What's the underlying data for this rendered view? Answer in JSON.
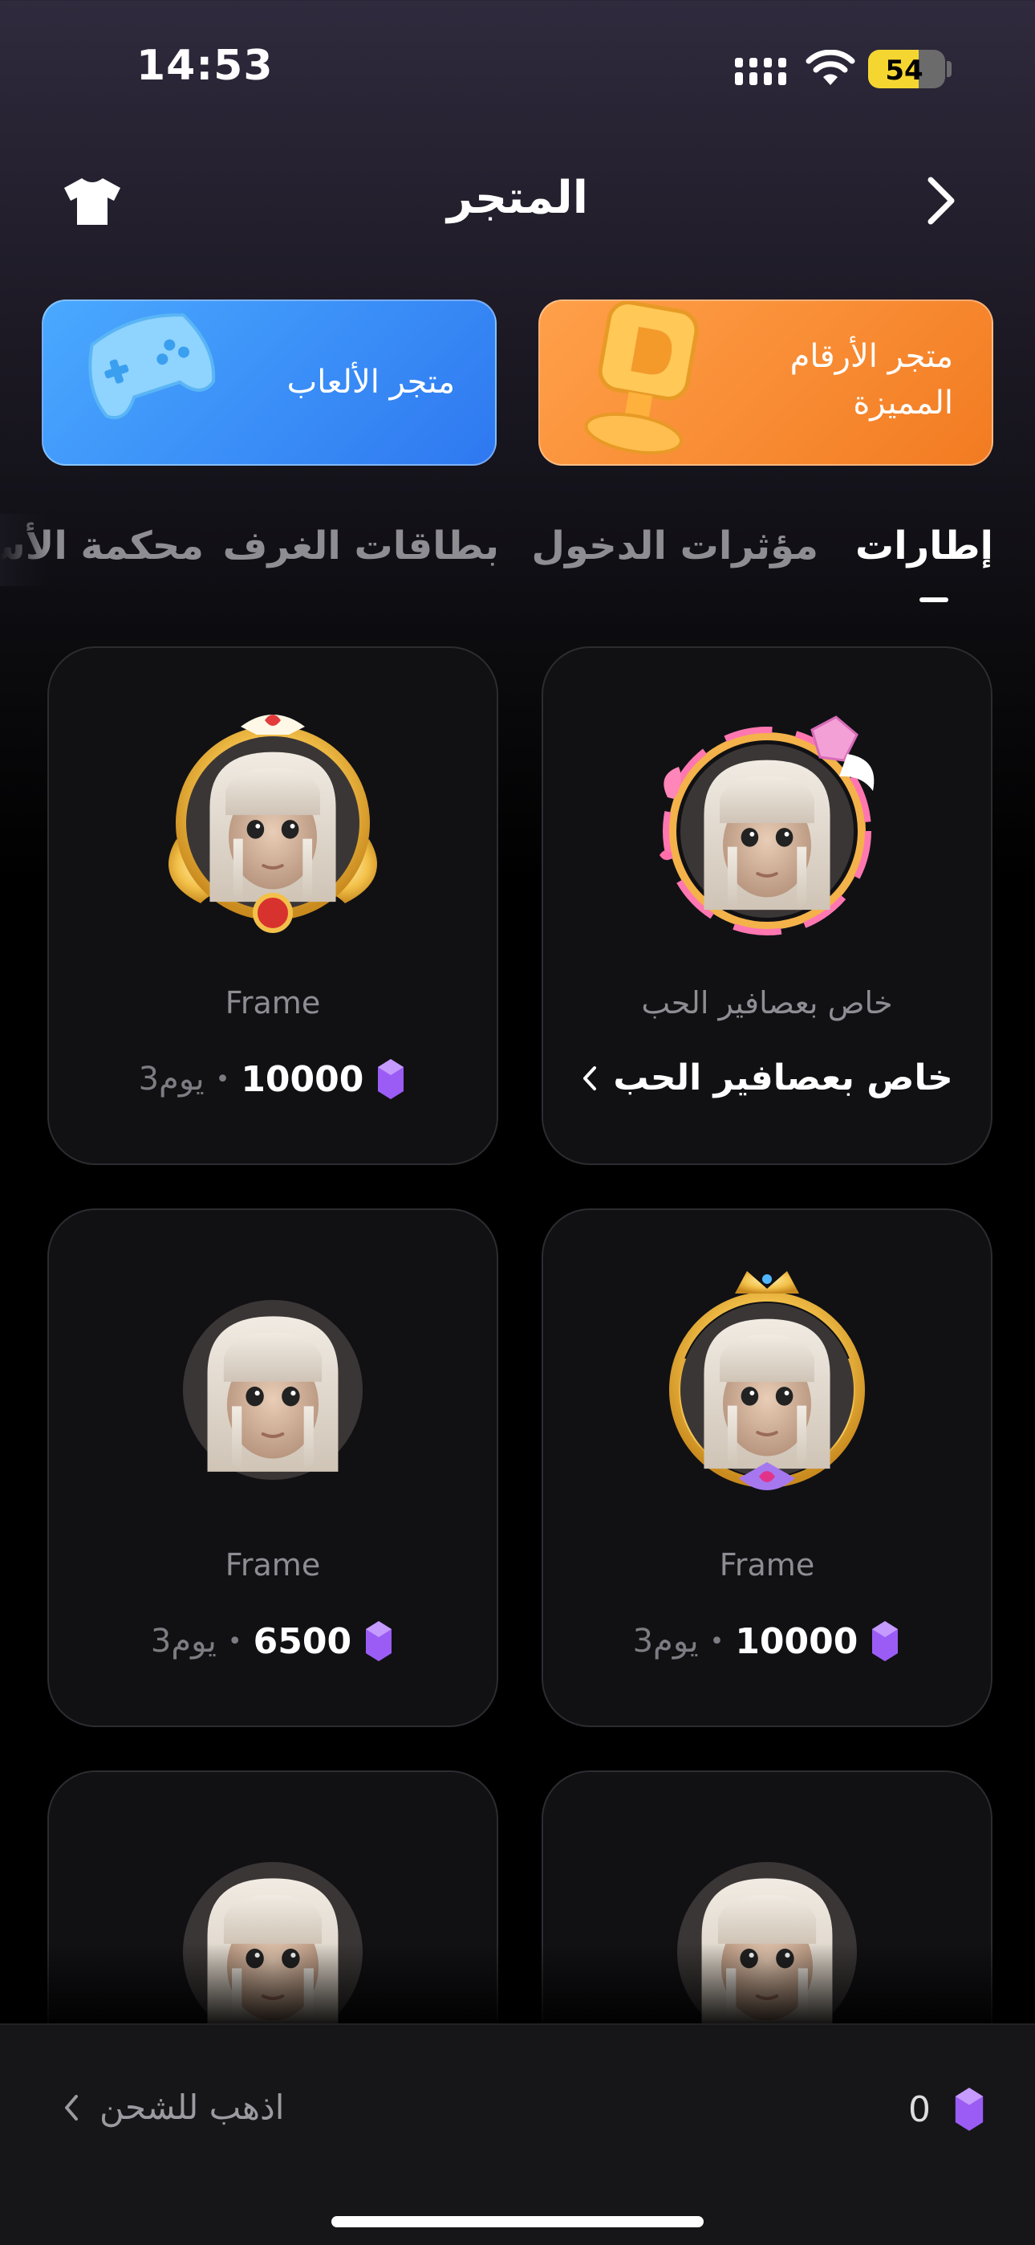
{
  "status_bar": {
    "time": "14:53",
    "battery": "54",
    "battery_level": 0.54
  },
  "header": {
    "title": "المتجر",
    "wardrobe_icon": "tshirt-icon",
    "back_icon": "chevron-right-icon"
  },
  "banners": [
    {
      "label": "متجر الألعاب",
      "icon": "gamepad-icon",
      "color": "#3b8ef6"
    },
    {
      "label": "متجر الأرقام المميزة",
      "icon": "trophy-icon",
      "color": "#f5892e"
    }
  ],
  "tabs": [
    {
      "label": "إطارات",
      "active": true
    },
    {
      "label": "مؤثرات الدخول",
      "active": false
    },
    {
      "label": "بطاقات الغرف",
      "active": false
    },
    {
      "label": "محكمة الأس",
      "active": false
    }
  ],
  "products": [
    {
      "subtitle": "خاص بعصافير الحب",
      "name": "خاص بعصافير الحب",
      "frame": "love-birds-frame"
    },
    {
      "subtitle": "Frame",
      "price": "10000",
      "days": "3يوم",
      "frame": "golden-wings-frame"
    },
    {
      "subtitle": "Frame",
      "price": "10000",
      "days": "3يوم",
      "frame": "golden-laurel-crown-frame"
    },
    {
      "subtitle": "Frame",
      "price": "6500",
      "days": "3يوم",
      "frame": "plain-frame"
    },
    {
      "frame": "plain-frame"
    },
    {
      "frame": "plain-frame"
    }
  ],
  "bottom_bar": {
    "balance": "0",
    "recharge_label": "اذهب للشحن",
    "gem_color": "#9b5cf5"
  }
}
